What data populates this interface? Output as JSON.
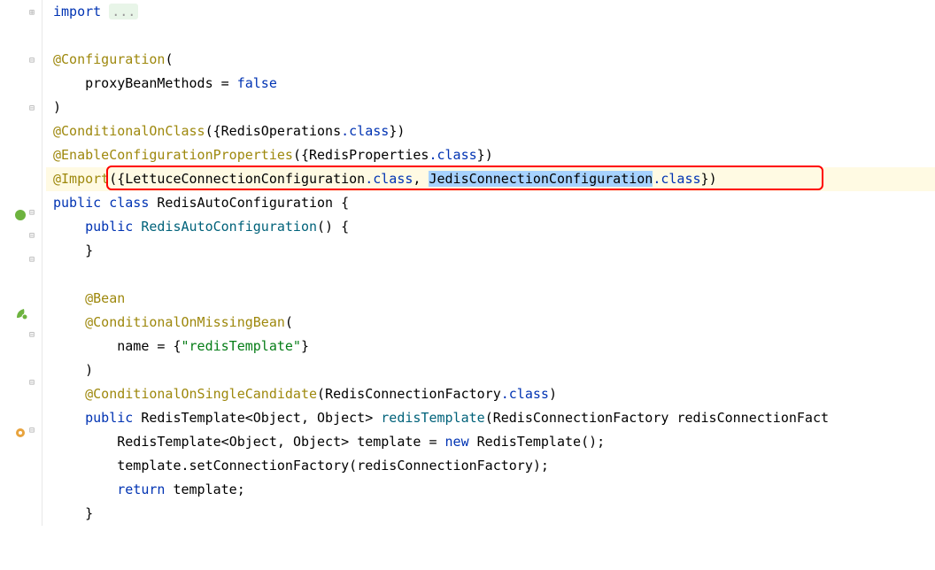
{
  "code": {
    "import_kw": "import",
    "import_folded": "...",
    "ann_configuration": "@Configuration",
    "paren_open": "(",
    "proxyBeanMethods": "proxyBeanMethods",
    "equals": " = ",
    "false_val": "false",
    "paren_close": ")",
    "ann_conditionalOnClass": "@ConditionalOnClass",
    "redisOperations": "RedisOperations",
    "dot_class": ".class",
    "brace_open": "{",
    "brace_close": "}",
    "ann_enableConfigProps": "@EnableConfigurationProperties",
    "redisProperties": "RedisProperties",
    "ann_import": "@Import",
    "lettuceConfig": "LettuceConnectionConfiguration",
    "jedisConfig": "JedisConnectionConfiguration",
    "comma_sp": ", ",
    "public_kw": "public",
    "class_kw": "class",
    "className": "RedisAutoConfiguration",
    "constructor": "RedisAutoConfiguration",
    "empty_parens": "()",
    "ann_bean": "@Bean",
    "ann_conditionalOnMissingBean": "@ConditionalOnMissingBean",
    "name_attr": "name",
    "redisTemplate_str": "\"redisTemplate\"",
    "ann_conditionalOnSingleCandidate": "@ConditionalOnSingleCandidate",
    "redisConnectionFactory": "RedisConnectionFactory",
    "redisTemplate_type": "RedisTemplate",
    "object_type": "Object",
    "lt": "<",
    "gt": ">",
    "redisTemplate_method": "redisTemplate",
    "param_name": "redisConnectionFactory",
    "template_var": "template",
    "new_kw": "new",
    "setConnectionFactory": "setConnectionFactory",
    "return_kw": "return",
    "semicolon": ";",
    "space": " ",
    "truncated_param": "redisConnectionFact"
  },
  "gutter": {
    "fold_plus": "⊞",
    "fold_minus": "⊟"
  }
}
